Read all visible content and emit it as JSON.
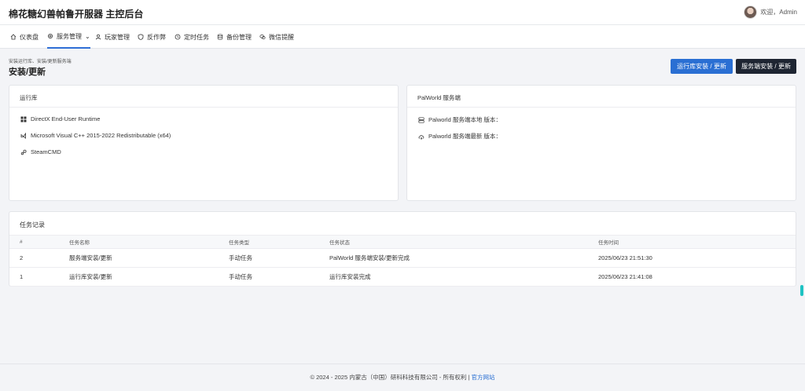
{
  "app": {
    "title": "棉花糖幻兽帕鲁开服器 主控后台"
  },
  "user": {
    "greeting": "欢迎，Admin"
  },
  "nav": {
    "items": [
      {
        "label": "仪表盘",
        "icon": "home-icon"
      },
      {
        "label": "服务管理",
        "icon": "gear-icon",
        "caret": "⌄"
      },
      {
        "label": "玩家管理",
        "icon": "user-icon"
      },
      {
        "label": "反作弊",
        "icon": "shield-icon"
      },
      {
        "label": "定时任务",
        "icon": "clock-icon"
      },
      {
        "label": "备份管理",
        "icon": "database-icon"
      },
      {
        "label": "微信提醒",
        "icon": "wechat-icon"
      }
    ]
  },
  "page": {
    "breadcrumb": "安装运行库、安装/更新服务端",
    "title": "安装/更新",
    "buttons": {
      "runtime": "运行库安装 / 更新",
      "server": "服务端安装 / 更新"
    }
  },
  "runtime_card": {
    "title": "运行库",
    "items": [
      {
        "label": "DirectX End-User Runtime",
        "icon": "windows-icon"
      },
      {
        "label": "Microsoft Visual C++ 2015-2022 Redistributable (x64)",
        "icon": "visual-studio-icon"
      },
      {
        "label": "SteamCMD",
        "icon": "steam-icon"
      }
    ]
  },
  "server_card": {
    "title": "PalWorld 服务端",
    "items": [
      {
        "label": "Palworld 服务端本地 版本：",
        "icon": "server-icon"
      },
      {
        "label": "Palworld 服务端最新 版本：",
        "icon": "cloud-icon"
      }
    ]
  },
  "tasks": {
    "title": "任务记录",
    "columns": [
      "#",
      "任务名称",
      "任务类型",
      "任务状态",
      "任务时间"
    ],
    "rows": [
      [
        "2",
        "服务端安装/更新",
        "手动任务",
        "PalWorld 服务端安装/更新完成",
        "2025/06/23 21:51:30"
      ],
      [
        "1",
        "运行库安装/更新",
        "手动任务",
        "运行库安装完成",
        "2025/06/23 21:41:08"
      ]
    ]
  },
  "footer": {
    "text": "© 2024 - 2025 内蒙古（中国）研科科技有限公司 - 所有权利 | ",
    "link": "官方网站"
  },
  "colors": {
    "primary": "#2a6fd3",
    "dark": "#1e2532",
    "accent": "#1fc3c3"
  }
}
